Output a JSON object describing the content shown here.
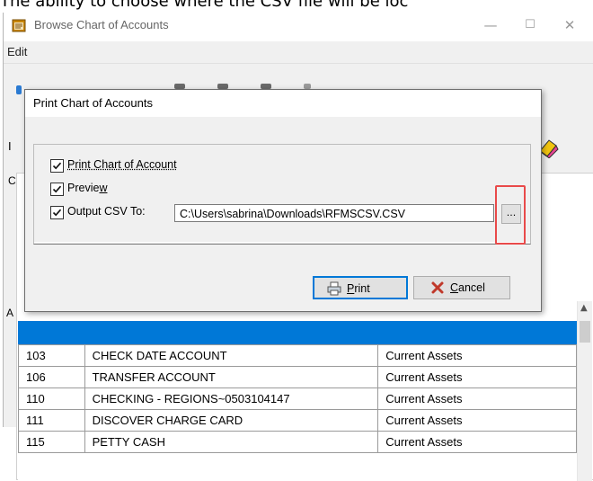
{
  "caption": "The ability to choose where the CSV file will be loc",
  "window": {
    "title": "Browse Chart of Accounts",
    "minimize_glyph": "—",
    "maximize_glyph": "☐",
    "close_glyph": "✕"
  },
  "menu": {
    "edit": "Edit"
  },
  "side_letters": {
    "left1": "I",
    "left2": "C",
    "left3": "A"
  },
  "dialog": {
    "title": "Print Chart of Accounts",
    "print_chart": {
      "checked": true,
      "label": "Print Chart of Account"
    },
    "preview": {
      "checked": true,
      "label_prefix": "Previe",
      "label_underline": "w"
    },
    "output_csv": {
      "checked": true,
      "label": "Output CSV To:",
      "path": "C:\\Users\\sabrina\\Downloads\\RFMSCSV.CSV"
    },
    "browse_label": "...",
    "print_button": {
      "underline": "P",
      "rest": "rint"
    },
    "cancel_button": {
      "underline": "C",
      "rest": "ancel"
    }
  },
  "grid": {
    "rows": [
      {
        "number": "103",
        "description": "CHECK DATE ACCOUNT",
        "type": "Current Assets"
      },
      {
        "number": "106",
        "description": "TRANSFER ACCOUNT",
        "type": "Current Assets"
      },
      {
        "number": "110",
        "description": "CHECKING - REGIONS~0503104147",
        "type": "Current Assets"
      },
      {
        "number": "111",
        "description": "DISCOVER CHARGE CARD",
        "type": "Current Assets"
      },
      {
        "number": "115",
        "description": "PETTY CASH",
        "type": "Current Assets"
      }
    ]
  },
  "colors": {
    "accent": "#0078d7",
    "highlight": "#e94a4a",
    "dialog_bg": "#f0f0f0"
  },
  "icons": [
    "app-icon",
    "checkmark-icon",
    "printer-icon",
    "cancel-x-icon",
    "eraser-tool-icon",
    "scroll-up-arrow-icon"
  ]
}
